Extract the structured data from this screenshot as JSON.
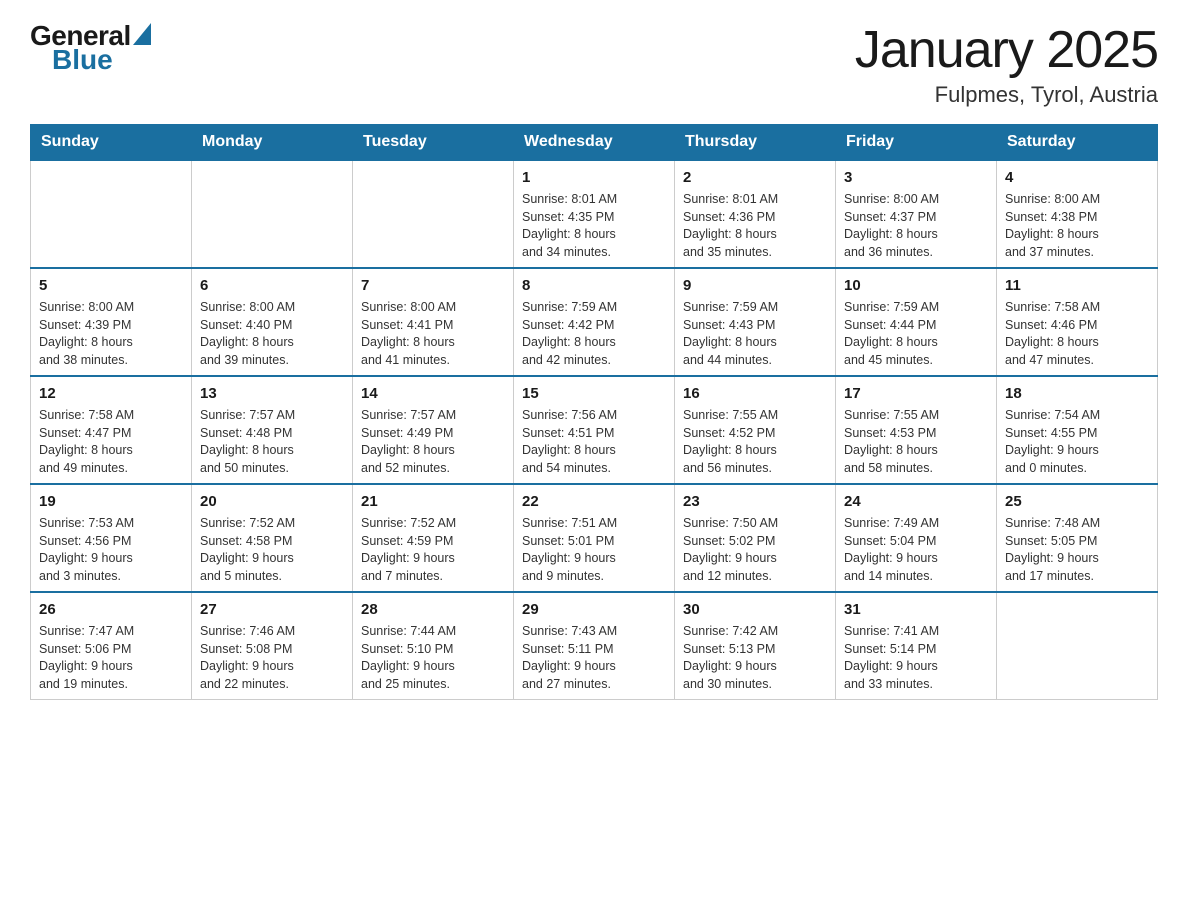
{
  "header": {
    "logo_general": "General",
    "logo_blue": "Blue",
    "month_title": "January 2025",
    "location": "Fulpmes, Tyrol, Austria"
  },
  "weekdays": [
    "Sunday",
    "Monday",
    "Tuesday",
    "Wednesday",
    "Thursday",
    "Friday",
    "Saturday"
  ],
  "weeks": [
    [
      {
        "day": "",
        "info": ""
      },
      {
        "day": "",
        "info": ""
      },
      {
        "day": "",
        "info": ""
      },
      {
        "day": "1",
        "info": "Sunrise: 8:01 AM\nSunset: 4:35 PM\nDaylight: 8 hours\nand 34 minutes."
      },
      {
        "day": "2",
        "info": "Sunrise: 8:01 AM\nSunset: 4:36 PM\nDaylight: 8 hours\nand 35 minutes."
      },
      {
        "day": "3",
        "info": "Sunrise: 8:00 AM\nSunset: 4:37 PM\nDaylight: 8 hours\nand 36 minutes."
      },
      {
        "day": "4",
        "info": "Sunrise: 8:00 AM\nSunset: 4:38 PM\nDaylight: 8 hours\nand 37 minutes."
      }
    ],
    [
      {
        "day": "5",
        "info": "Sunrise: 8:00 AM\nSunset: 4:39 PM\nDaylight: 8 hours\nand 38 minutes."
      },
      {
        "day": "6",
        "info": "Sunrise: 8:00 AM\nSunset: 4:40 PM\nDaylight: 8 hours\nand 39 minutes."
      },
      {
        "day": "7",
        "info": "Sunrise: 8:00 AM\nSunset: 4:41 PM\nDaylight: 8 hours\nand 41 minutes."
      },
      {
        "day": "8",
        "info": "Sunrise: 7:59 AM\nSunset: 4:42 PM\nDaylight: 8 hours\nand 42 minutes."
      },
      {
        "day": "9",
        "info": "Sunrise: 7:59 AM\nSunset: 4:43 PM\nDaylight: 8 hours\nand 44 minutes."
      },
      {
        "day": "10",
        "info": "Sunrise: 7:59 AM\nSunset: 4:44 PM\nDaylight: 8 hours\nand 45 minutes."
      },
      {
        "day": "11",
        "info": "Sunrise: 7:58 AM\nSunset: 4:46 PM\nDaylight: 8 hours\nand 47 minutes."
      }
    ],
    [
      {
        "day": "12",
        "info": "Sunrise: 7:58 AM\nSunset: 4:47 PM\nDaylight: 8 hours\nand 49 minutes."
      },
      {
        "day": "13",
        "info": "Sunrise: 7:57 AM\nSunset: 4:48 PM\nDaylight: 8 hours\nand 50 minutes."
      },
      {
        "day": "14",
        "info": "Sunrise: 7:57 AM\nSunset: 4:49 PM\nDaylight: 8 hours\nand 52 minutes."
      },
      {
        "day": "15",
        "info": "Sunrise: 7:56 AM\nSunset: 4:51 PM\nDaylight: 8 hours\nand 54 minutes."
      },
      {
        "day": "16",
        "info": "Sunrise: 7:55 AM\nSunset: 4:52 PM\nDaylight: 8 hours\nand 56 minutes."
      },
      {
        "day": "17",
        "info": "Sunrise: 7:55 AM\nSunset: 4:53 PM\nDaylight: 8 hours\nand 58 minutes."
      },
      {
        "day": "18",
        "info": "Sunrise: 7:54 AM\nSunset: 4:55 PM\nDaylight: 9 hours\nand 0 minutes."
      }
    ],
    [
      {
        "day": "19",
        "info": "Sunrise: 7:53 AM\nSunset: 4:56 PM\nDaylight: 9 hours\nand 3 minutes."
      },
      {
        "day": "20",
        "info": "Sunrise: 7:52 AM\nSunset: 4:58 PM\nDaylight: 9 hours\nand 5 minutes."
      },
      {
        "day": "21",
        "info": "Sunrise: 7:52 AM\nSunset: 4:59 PM\nDaylight: 9 hours\nand 7 minutes."
      },
      {
        "day": "22",
        "info": "Sunrise: 7:51 AM\nSunset: 5:01 PM\nDaylight: 9 hours\nand 9 minutes."
      },
      {
        "day": "23",
        "info": "Sunrise: 7:50 AM\nSunset: 5:02 PM\nDaylight: 9 hours\nand 12 minutes."
      },
      {
        "day": "24",
        "info": "Sunrise: 7:49 AM\nSunset: 5:04 PM\nDaylight: 9 hours\nand 14 minutes."
      },
      {
        "day": "25",
        "info": "Sunrise: 7:48 AM\nSunset: 5:05 PM\nDaylight: 9 hours\nand 17 minutes."
      }
    ],
    [
      {
        "day": "26",
        "info": "Sunrise: 7:47 AM\nSunset: 5:06 PM\nDaylight: 9 hours\nand 19 minutes."
      },
      {
        "day": "27",
        "info": "Sunrise: 7:46 AM\nSunset: 5:08 PM\nDaylight: 9 hours\nand 22 minutes."
      },
      {
        "day": "28",
        "info": "Sunrise: 7:44 AM\nSunset: 5:10 PM\nDaylight: 9 hours\nand 25 minutes."
      },
      {
        "day": "29",
        "info": "Sunrise: 7:43 AM\nSunset: 5:11 PM\nDaylight: 9 hours\nand 27 minutes."
      },
      {
        "day": "30",
        "info": "Sunrise: 7:42 AM\nSunset: 5:13 PM\nDaylight: 9 hours\nand 30 minutes."
      },
      {
        "day": "31",
        "info": "Sunrise: 7:41 AM\nSunset: 5:14 PM\nDaylight: 9 hours\nand 33 minutes."
      },
      {
        "day": "",
        "info": ""
      }
    ]
  ]
}
